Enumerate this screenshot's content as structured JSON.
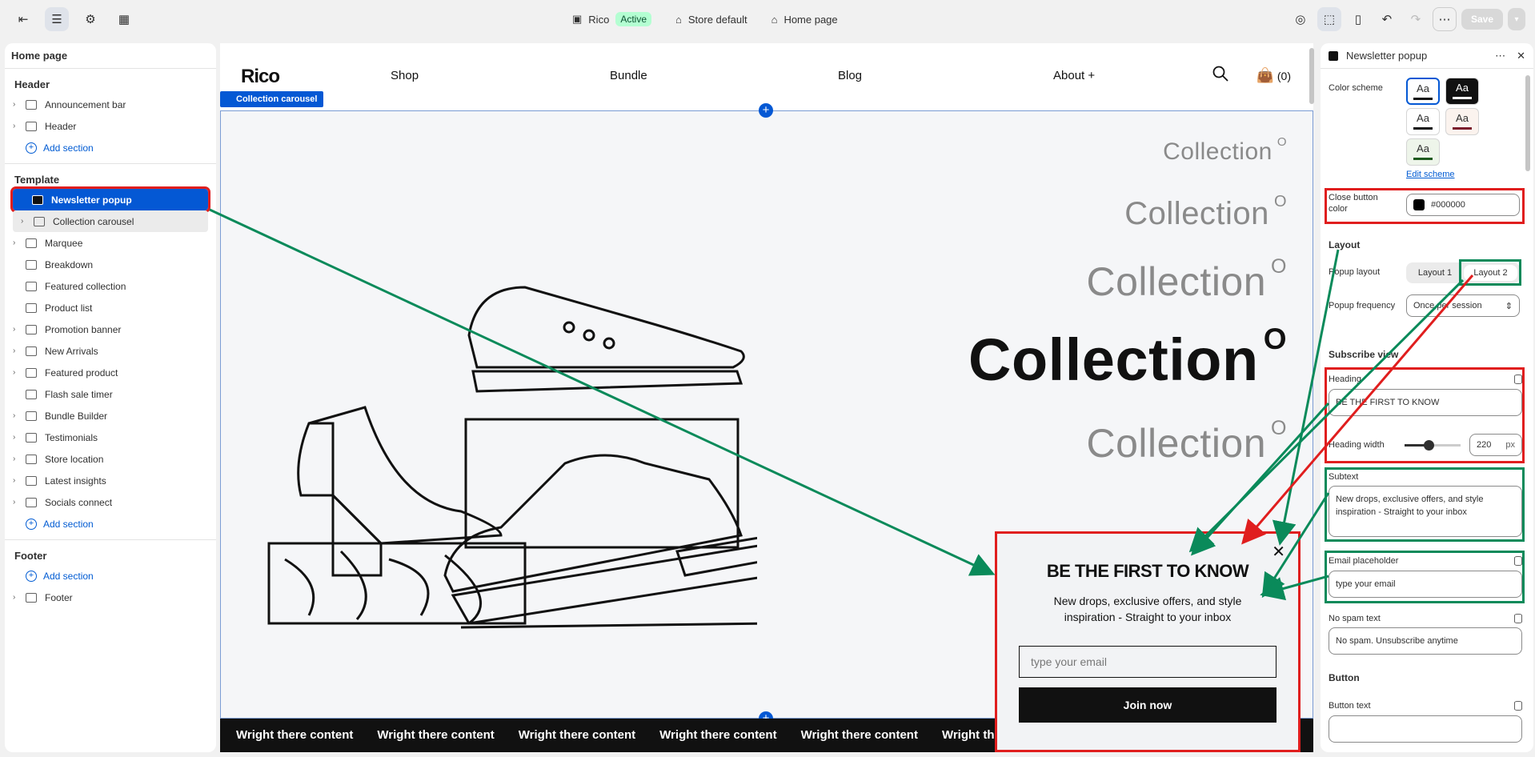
{
  "topbar": {
    "store_name": "Rico",
    "status": "Active",
    "theme": "Store default",
    "page": "Home page",
    "save": "Save"
  },
  "sidebar": {
    "title": "Home page",
    "header_group": "Header",
    "header_items": [
      "Announcement bar",
      "Header"
    ],
    "add_section": "Add section",
    "template_group": "Template",
    "template_items": [
      "Newsletter popup",
      "Collection carousel",
      "Marquee",
      "Breakdown",
      "Featured collection",
      "Product list",
      "Promotion banner",
      "New Arrivals",
      "Featured product",
      "Flash sale timer",
      "Bundle Builder",
      "Testimonials",
      "Store location",
      "Latest insights",
      "Socials connect"
    ],
    "footer_group": "Footer",
    "footer_items": [
      "Footer"
    ]
  },
  "store": {
    "logo": "Rico",
    "nav": [
      "Shop",
      "Bundle",
      "Blog",
      "About +"
    ],
    "cart": "(0)",
    "section_tag": "Collection carousel",
    "collection_word": "Collection",
    "collection_sup": "O",
    "marquee_text": "Wright there content"
  },
  "popup": {
    "heading": "BE THE FIRST TO KNOW",
    "subtext": "New drops, exclusive offers, and style inspiration - Straight to your inbox",
    "email_placeholder": "type your email",
    "button": "Join now"
  },
  "panel": {
    "title": "Newsletter popup",
    "color_scheme_label": "Color scheme",
    "swatch_text": "Aa",
    "edit_scheme": "Edit scheme",
    "close_button_color_label": "Close button color",
    "close_button_color_value": "#000000",
    "layout_section": "Layout",
    "popup_layout_label": "Popup layout",
    "layout_options": [
      "Layout 1",
      "Layout 2"
    ],
    "popup_frequency_label": "Popup frequency",
    "popup_frequency_value": "Once per session",
    "subscribe_section": "Subscribe view",
    "heading_label": "Heading",
    "heading_value": "BE THE FIRST TO KNOW",
    "heading_width_label": "Heading width",
    "heading_width_value": "220",
    "heading_width_unit": "px",
    "subtext_label": "Subtext",
    "subtext_value": "New drops, exclusive offers, and style inspiration - Straight to your inbox",
    "email_placeholder_label": "Email placeholder",
    "email_placeholder_value": "type your email",
    "no_spam_label": "No spam text",
    "no_spam_value": "No spam. Unsubscribe anytime",
    "button_section": "Button",
    "button_text_label": "Button text"
  },
  "colors": {
    "accent_blue": "#0458d4",
    "annotation_red": "#e01e1e",
    "annotation_green": "#0a8a5a"
  }
}
